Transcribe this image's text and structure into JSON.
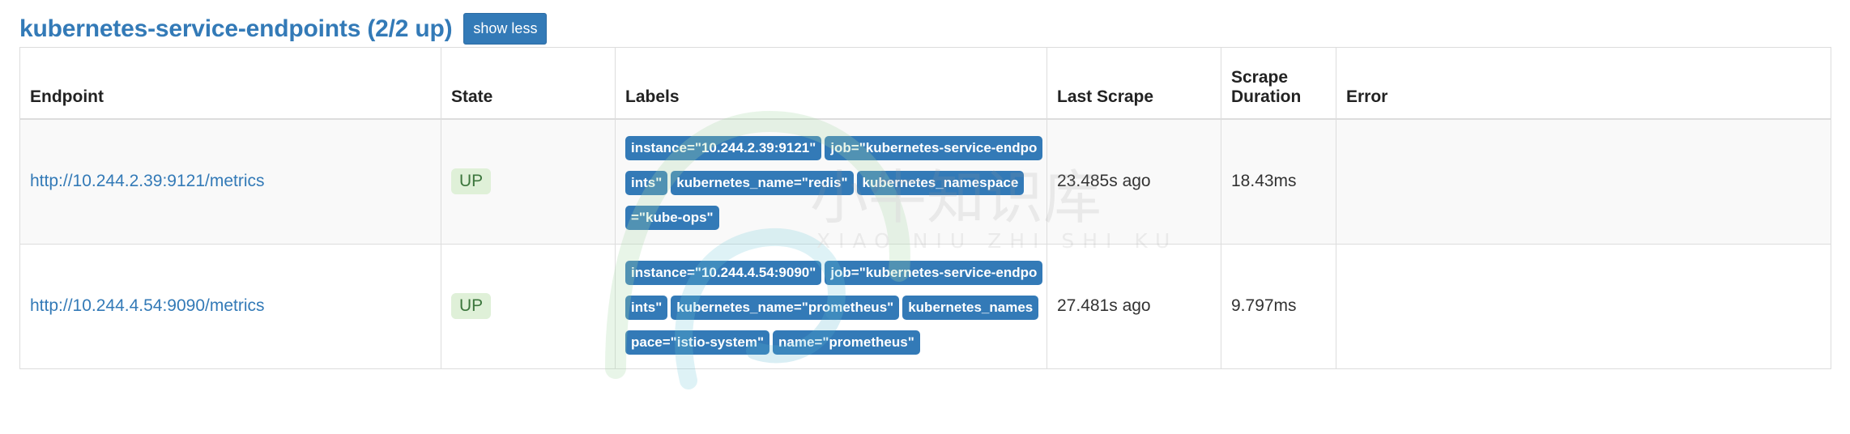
{
  "header": {
    "job_title": "kubernetes-service-endpoints (2/2 up)",
    "show_less_label": "show less",
    "title_color": "#337ab7",
    "button_bg": "#337ab7"
  },
  "table": {
    "columns": [
      "Endpoint",
      "State",
      "Labels",
      "Last Scrape",
      "Scrape Duration",
      "Error"
    ],
    "rows": [
      {
        "endpoint": "http://10.244.2.39:9121/metrics",
        "state": "UP",
        "labels": [
          "instance=\"10.244.2.39:9121\"",
          "job=\"kubernetes-service-endpoints\"",
          "kubernetes_name=\"redis\"",
          "kubernetes_namespace=\"kube-ops\""
        ],
        "last_scrape": "23.485s ago",
        "scrape_duration": "18.43ms",
        "error": ""
      },
      {
        "endpoint": "http://10.244.4.54:9090/metrics",
        "state": "UP",
        "labels": [
          "instance=\"10.244.4.54:9090\"",
          "job=\"kubernetes-service-endpoints\"",
          "kubernetes_name=\"prometheus\"",
          "kubernetes_namespace=\"istio-system\"",
          "name=\"prometheus\""
        ],
        "last_scrape": "27.481s ago",
        "scrape_duration": "9.797ms",
        "error": ""
      }
    ]
  },
  "watermark": {
    "text": "小牛知识库",
    "subtext": "XIAO NIU ZHI SHI KU"
  },
  "colors": {
    "state_up_bg": "#dff0d8",
    "state_up_text": "#3c763d",
    "label_chip_bg": "#337ab7",
    "link": "#337ab7"
  }
}
